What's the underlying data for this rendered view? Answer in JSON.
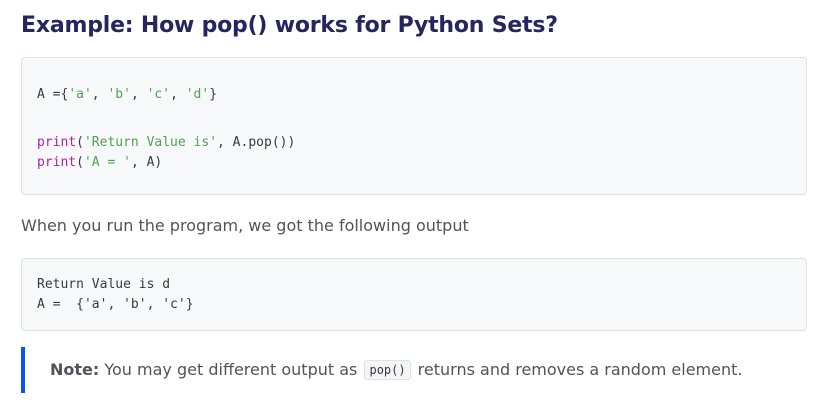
{
  "heading": "Example: How pop() works for Python Sets?",
  "example_code": {
    "line1": {
      "var": "A =",
      "open": "{",
      "s1": "'a'",
      "c1": ", ",
      "s2": "'b'",
      "c2": ", ",
      "s3": "'c'",
      "c3": ", ",
      "s4": "'d'",
      "close": "}"
    },
    "line2": {
      "fn": "print",
      "open": "(",
      "str": "'Return Value is'",
      "rest": ", A.pop())"
    },
    "line3": {
      "fn": "print",
      "open": "(",
      "str": "'A = '",
      "rest": ", A)"
    }
  },
  "description": "When you run the program, we got the following output",
  "output_lines": [
    "Return Value is d",
    "A =  {'a', 'b', 'c'}"
  ],
  "note": {
    "label": "Note:",
    "text_before": " You may get different output as ",
    "code": "pop()",
    "text_after": " returns and removes a random element."
  },
  "colors": {
    "heading": "#25265e",
    "string": "#50a14f",
    "keyword": "#a626a4",
    "note_accent": "#0556f3"
  }
}
